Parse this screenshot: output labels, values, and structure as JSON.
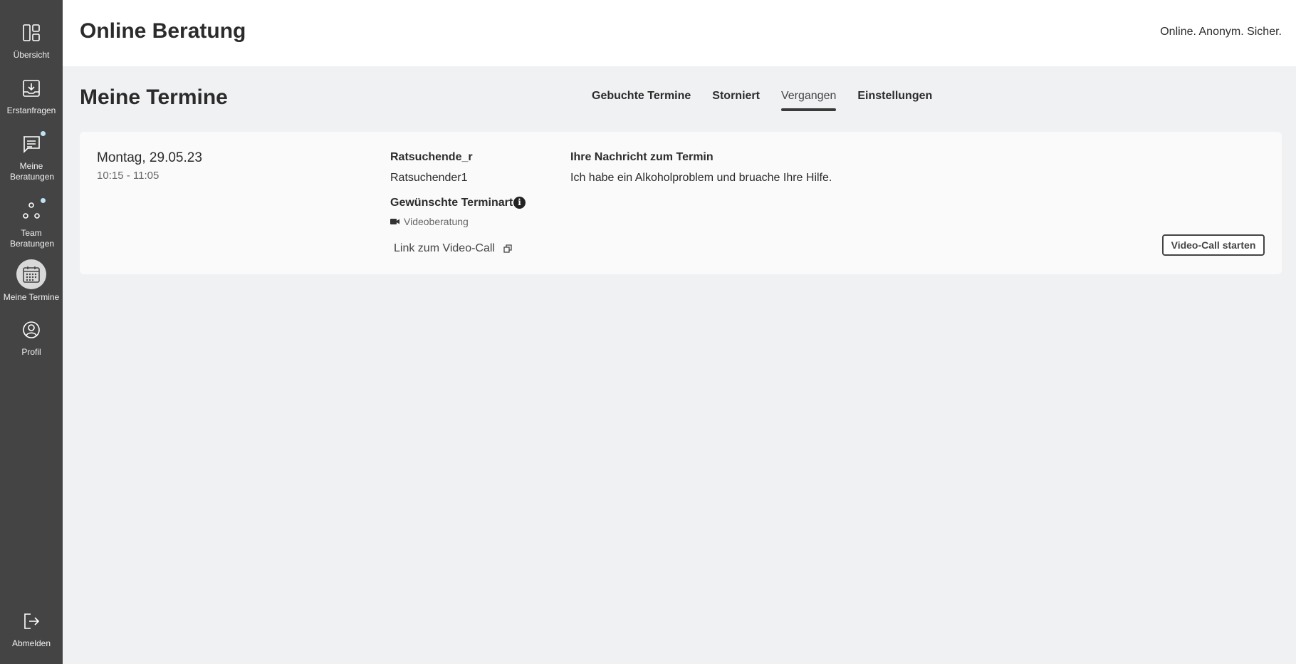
{
  "header": {
    "title": "Online Beratung",
    "claim": "Online. Anonym. Sicher."
  },
  "sidebar": {
    "items": [
      {
        "label": "Übersicht",
        "icon": "overview-icon"
      },
      {
        "label": "Erstanfragen",
        "icon": "inbox-icon"
      },
      {
        "label": "Meine Beratungen",
        "icon": "chat-icon",
        "badge": true
      },
      {
        "label": "Team Beratungen",
        "icon": "team-icon",
        "badge": true
      },
      {
        "label": "Meine Termine",
        "icon": "calendar-icon",
        "active": true
      },
      {
        "label": "Profil",
        "icon": "profile-icon"
      }
    ],
    "logout": {
      "label": "Abmelden",
      "icon": "logout-icon"
    }
  },
  "page": {
    "title": "Meine Termine",
    "tabs": [
      {
        "label": "Gebuchte Termine",
        "active": false
      },
      {
        "label": "Storniert",
        "active": false
      },
      {
        "label": "Vergangen",
        "active": true
      },
      {
        "label": "Einstellungen",
        "active": false
      }
    ]
  },
  "appointment": {
    "date": "Montag, 29.05.23",
    "time": "10:15 - 11:05",
    "asker_name": "Ratsuchende_r",
    "asker_username": "Ratsuchender1",
    "type_label": "Gewünschte Terminart",
    "type_value": "Videoberatung",
    "link_label": "Link zum Video-Call",
    "message_title": "Ihre Nachricht zum Termin",
    "message_text": "Ich habe ein Alkoholproblem und bruache Ihre Hilfe.",
    "start_button": "Video-Call starten"
  },
  "colors": {
    "sidebar_bg": "#444444",
    "page_bg": "#f0f1f3",
    "badge_dot": "#bfe3f2"
  }
}
